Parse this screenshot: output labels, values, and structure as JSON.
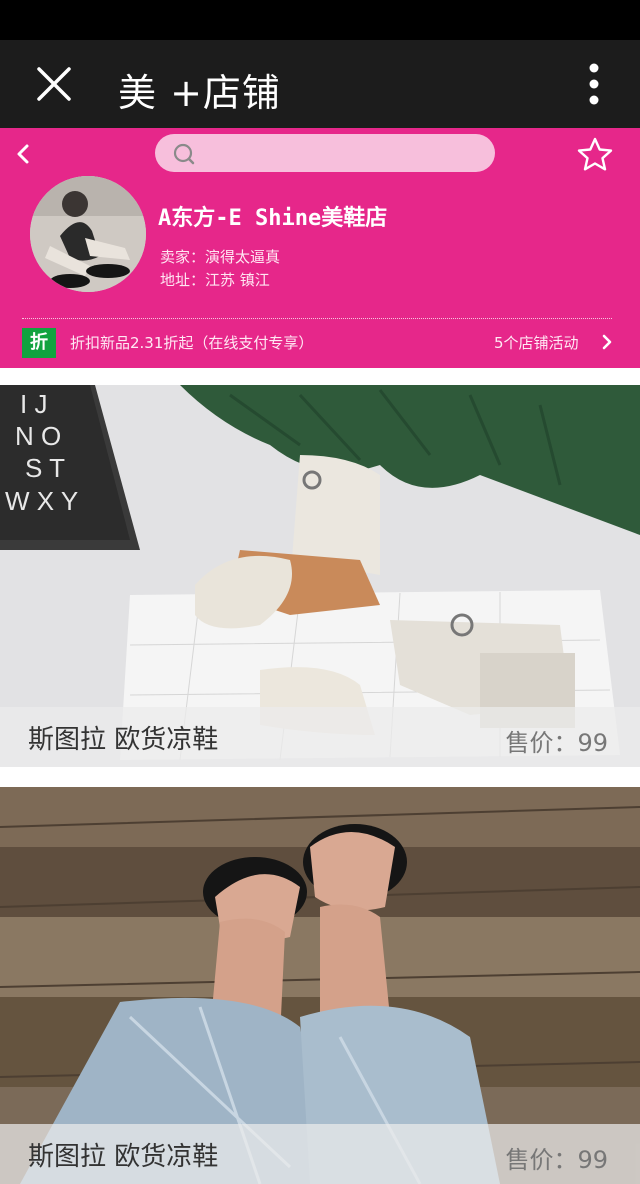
{
  "app_bar": {
    "title": "美 +店铺",
    "close_icon": "close-icon",
    "more_icon": "more-vertical-icon"
  },
  "store": {
    "search": {
      "value": "",
      "placeholder": ""
    },
    "name": "A东方-E Shine美鞋店",
    "seller": "卖家：演得太逼真",
    "address": "地址：江苏 镇江",
    "promo": {
      "badge": "折",
      "text": "折扣新品2.31折起（在线支付专享）",
      "activity_link": "5个店铺活动"
    },
    "colors": {
      "header": "#e6278a",
      "badge": "#12a33f"
    }
  },
  "products": [
    {
      "name": "斯图拉 欧货凉鞋",
      "price": "售价：99"
    },
    {
      "name": "斯图拉 欧货凉鞋",
      "price": "售价：99"
    }
  ]
}
